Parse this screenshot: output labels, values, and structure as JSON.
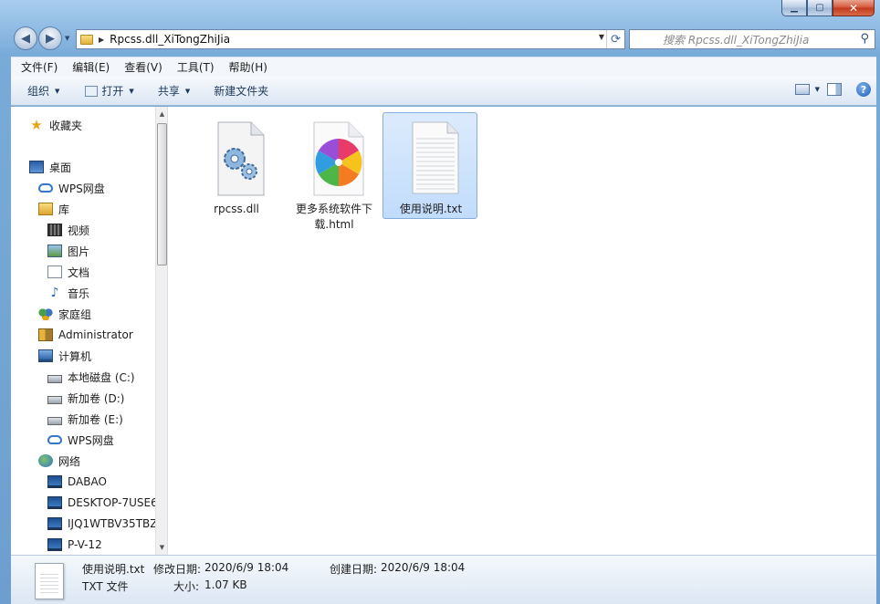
{
  "window": {
    "address_path": "Rpcss.dll_XiTongZhiJia",
    "search_placeholder": "搜索 Rpcss.dll_XiTongZhiJia"
  },
  "menu": [
    "文件(F)",
    "编辑(E)",
    "查看(V)",
    "工具(T)",
    "帮助(H)"
  ],
  "toolbar": {
    "organize": "组织",
    "open": "打开",
    "share": "共享",
    "new_folder": "新建文件夹"
  },
  "sidebar": {
    "favorites": "收藏夹",
    "desktop": "桌面",
    "wps_cloud": "WPS网盘",
    "libraries": "库",
    "videos": "视频",
    "pictures": "图片",
    "documents": "文档",
    "music": "音乐",
    "homegroup": "家庭组",
    "administrator": "Administrator",
    "computer": "计算机",
    "drive_c": "本地磁盘 (C:)",
    "drive_d": "新加卷 (D:)",
    "drive_e": "新加卷 (E:)",
    "wps_cloud2": "WPS网盘",
    "network": "网络",
    "net_dabao": "DABAO",
    "net_desktop": "DESKTOP-7USE6",
    "net_ijq": "IJQ1WTBV35TBZ",
    "net_pv12": "P-V-12"
  },
  "files": [
    {
      "name": "rpcss.dll",
      "icon": "dll-gear-icon",
      "selected": false
    },
    {
      "name": "更多系统软件下载.html",
      "icon": "browser-pinwheel-icon",
      "selected": false
    },
    {
      "name": "使用说明.txt",
      "icon": "text-file-icon",
      "selected": true
    }
  ],
  "status": {
    "filename": "使用说明.txt",
    "filetype": "TXT 文件",
    "modified_label": "修改日期:",
    "modified_value": "2020/6/9 18:04",
    "created_label": "创建日期:",
    "created_value": "2020/6/9 18:04",
    "size_label": "大小:",
    "size_value": "1.07 KB"
  },
  "colors": {
    "selection": "#c1dcfc",
    "frame": "#79abd9"
  }
}
